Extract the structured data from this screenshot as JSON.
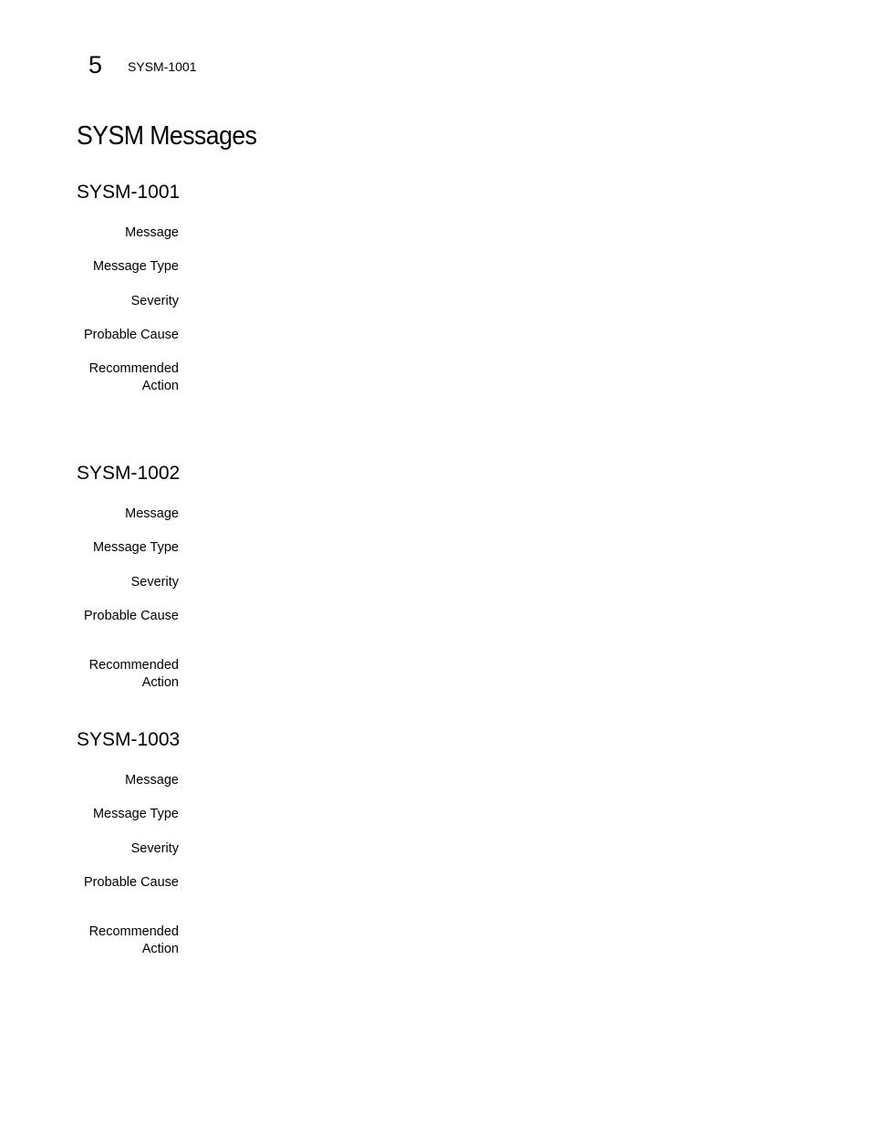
{
  "header": {
    "chapter_number": "5",
    "running_title": "SYSM-1001"
  },
  "page_title": "SYSM Messages",
  "messages": [
    {
      "id": "SYSM-1001",
      "fields": [
        {
          "label": "Message",
          "value": ""
        },
        {
          "label": "Message Type",
          "value": ""
        },
        {
          "label": "Severity",
          "value": ""
        },
        {
          "label": "Probable Cause",
          "value": ""
        },
        {
          "label": "Recommended Action",
          "value": ""
        }
      ]
    },
    {
      "id": "SYSM-1002",
      "fields": [
        {
          "label": "Message",
          "value": ""
        },
        {
          "label": "Message Type",
          "value": ""
        },
        {
          "label": "Severity",
          "value": ""
        },
        {
          "label": "Probable Cause",
          "value": ""
        },
        {
          "label": "Recommended Action",
          "value": ""
        }
      ]
    },
    {
      "id": "SYSM-1003",
      "fields": [
        {
          "label": "Message",
          "value": ""
        },
        {
          "label": "Message Type",
          "value": ""
        },
        {
          "label": "Severity",
          "value": ""
        },
        {
          "label": "Probable Cause",
          "value": ""
        },
        {
          "label": "Recommended Action",
          "value": ""
        }
      ]
    }
  ]
}
